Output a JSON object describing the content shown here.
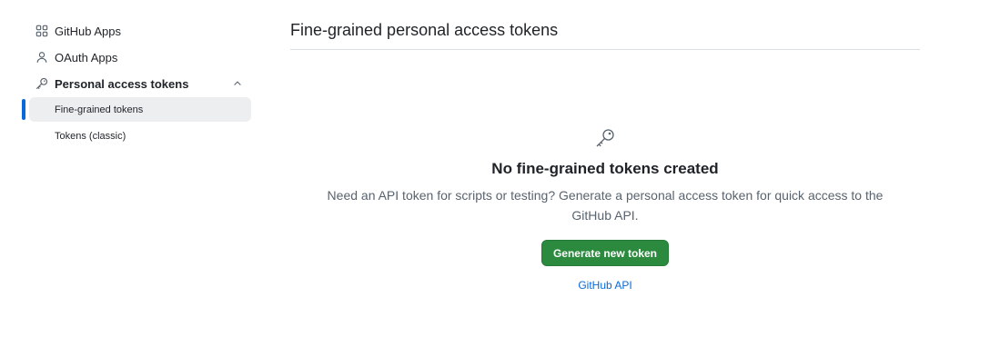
{
  "sidebar": {
    "items": [
      {
        "label": "GitHub Apps",
        "icon": "apps-grid-icon"
      },
      {
        "label": "OAuth Apps",
        "icon": "person-icon"
      },
      {
        "label": "Personal access tokens",
        "icon": "key-icon",
        "expanded": true
      }
    ],
    "subitems": [
      {
        "label": "Fine-grained tokens",
        "active": true
      },
      {
        "label": "Tokens (classic)",
        "active": false
      }
    ]
  },
  "main": {
    "title": "Fine-grained personal access tokens",
    "blank_slate": {
      "icon": "key-icon",
      "heading": "No fine-grained tokens created",
      "text": "Need an API token for scripts or testing? Generate a personal access token for quick access to the GitHub API.",
      "button_label": "Generate new token",
      "link_label": "GitHub API"
    }
  },
  "colors": {
    "accent": "#0969da",
    "primary_button": "#2c8a3f",
    "active_bg": "#eceef0"
  }
}
